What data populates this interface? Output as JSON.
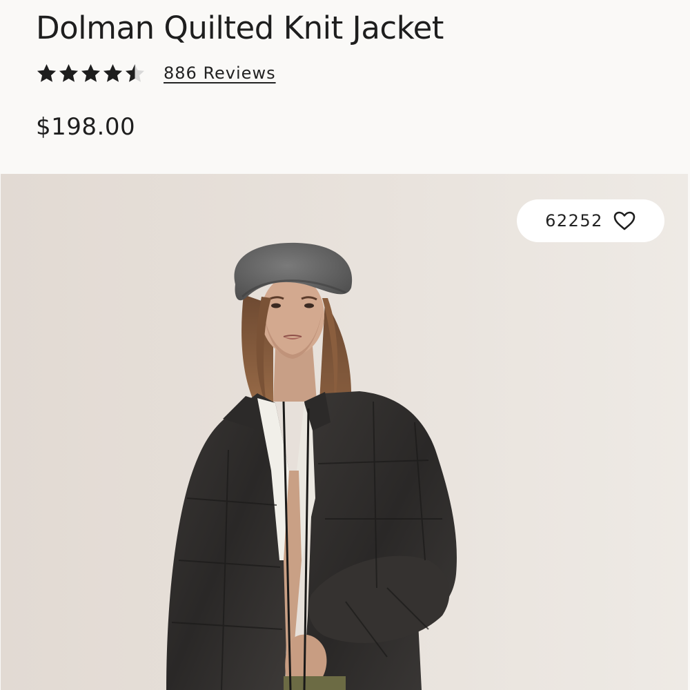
{
  "product": {
    "title": "Dolman Quilted Knit Jacket",
    "rating": 4.5,
    "rating_max": 5,
    "reviews_label": "886 Reviews",
    "price": "$198.00"
  },
  "image": {
    "alt": "Model wearing black quilted jacket and grey beret",
    "favorites_count": "62252"
  },
  "colors": {
    "text": "#1e1e1e",
    "background": "#faf9f7",
    "star": "#1e1e1e",
    "star_empty": "#d8d8d8"
  },
  "icons": {
    "star": "star-icon",
    "favorite": "heart-outline-icon"
  }
}
